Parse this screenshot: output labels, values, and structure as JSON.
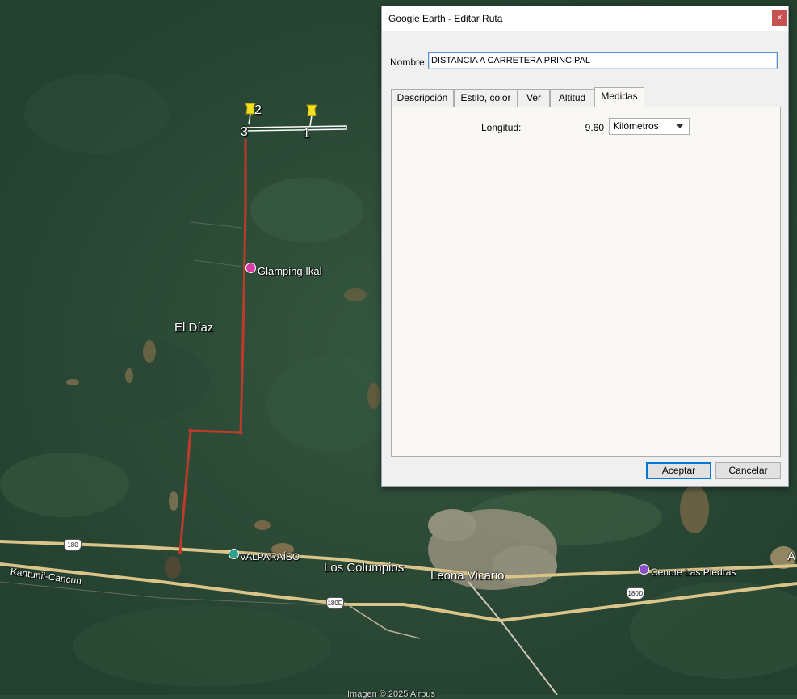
{
  "map": {
    "labels": {
      "el_diaz": "El Díaz",
      "glamping": "Glamping Ikal",
      "valparaiso": "VALPARAÍSO",
      "los_columpios": "Los Columpios",
      "leona_vicario": "Leona Vicario",
      "cenote": "Cenote Las Piedras",
      "kantunil": "Kantunil-Cancun",
      "edge_letter": "A",
      "imagery_credit": "Imagen © 2025 Airbus"
    },
    "shields": {
      "s180": "180",
      "s180d_a": "180D",
      "s180d_b": "180D"
    },
    "points": {
      "p1": "1",
      "p2": "2",
      "p3": "3"
    },
    "colors": {
      "path": "#c0392b",
      "road": "#d9c48a",
      "pin": "#f2e020",
      "poi_pink": "#d63ea5",
      "poi_teal": "#2f9e8a",
      "poi_violet": "#8a4fc8"
    }
  },
  "dialog": {
    "title": "Google Earth - Editar Ruta",
    "close_label": "×",
    "nombre_label": "Nombre:",
    "nombre_value": "DISTANCIA A CARRETERA PRINCIPAL",
    "tabs": [
      "Descripción",
      "Estilo, color",
      "Ver",
      "Altitud",
      "Medidas"
    ],
    "active_tab": "Medidas",
    "measure": {
      "label": "Longitud:",
      "value": "9.60",
      "unit": "Kilómetros"
    },
    "accept_label": "Aceptar",
    "cancel_label": "Cancelar"
  }
}
